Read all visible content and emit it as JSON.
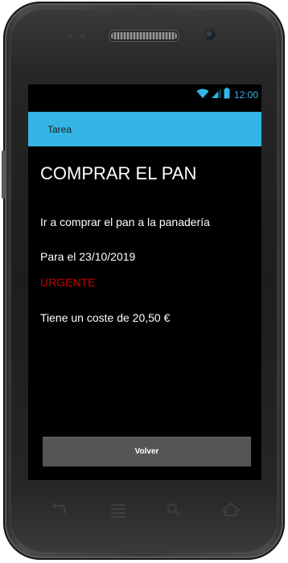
{
  "status_bar": {
    "time": "12:00",
    "icons": [
      "wifi-icon",
      "signal-icon",
      "battery-icon"
    ],
    "accent_color": "#33b5e5"
  },
  "action_bar": {
    "title": "Tarea",
    "color": "#33b5e5"
  },
  "task": {
    "title": "COMPRAR EL PAN",
    "description": "Ir a comprar el pan a la panadería",
    "date": "Para el 23/10/2019",
    "priority": "URGENTE",
    "priority_color": "#cc0000",
    "cost": "Tiene un coste de 20,50 €"
  },
  "buttons": {
    "back_label": "Volver"
  },
  "device_keys": [
    "back-icon",
    "menu-icon",
    "search-icon",
    "home-icon"
  ]
}
